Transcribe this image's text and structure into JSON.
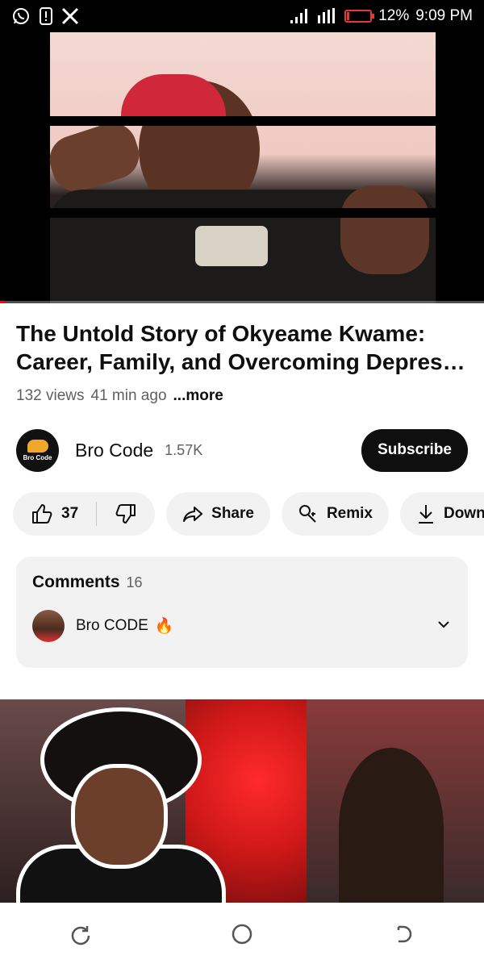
{
  "status_bar": {
    "battery_percent": "12%",
    "time": "9:09 PM",
    "battery_level": 0.12
  },
  "player": {
    "progress": 0.01
  },
  "video": {
    "title_line1": "The Untold Story of Okyeame Kwame:",
    "title_line2": "Career, Family, and Overcoming Depress…",
    "views": "132 views",
    "age": "41 min ago",
    "more": "...more"
  },
  "channel": {
    "name": "Bro Code",
    "subscribers": "1.57K",
    "logo_text": "Bro Code",
    "subscribe_label": "Subscribe"
  },
  "actions": {
    "likes": "37",
    "share": "Share",
    "remix": "Remix",
    "download": "Download"
  },
  "comments": {
    "title": "Comments",
    "count": "16",
    "top_comment_author": "Bro CODE",
    "top_comment_text": "🔥"
  },
  "colors": {
    "accent": "#ff0000",
    "battery_low": "#e53935"
  }
}
